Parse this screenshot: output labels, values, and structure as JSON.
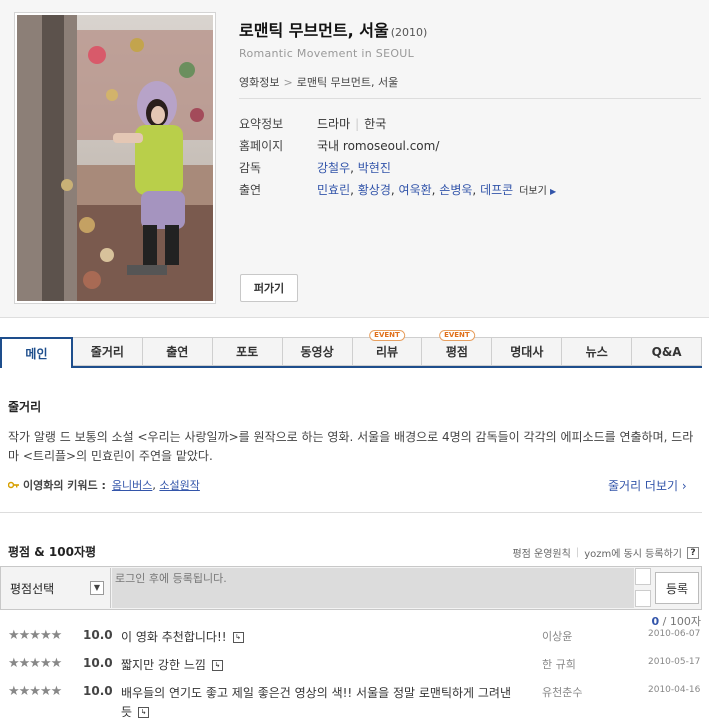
{
  "movie": {
    "title": "로맨틱 무브먼트, 서울",
    "year": "(2010)",
    "subtitle": "Romantic Movement in SEOUL"
  },
  "breadcrumb": [
    "영화정보",
    "로맨틱 무브먼트, 서울"
  ],
  "info": {
    "summary_label": "요약정보",
    "genre": "드라마",
    "country": "한국",
    "homepage_label": "홈페이지",
    "homepage_prefix": "국내",
    "homepage_url": "romoseoul.com/",
    "director_label": "감독",
    "directors": [
      "강철우",
      "박현진"
    ],
    "cast_label": "출연",
    "cast": [
      "민효린",
      "황상경",
      "여욱환",
      "손병욱",
      "데프콘"
    ],
    "cast_more": "더보기"
  },
  "scrap_button": "퍼가기",
  "tabs": [
    {
      "label": "메인",
      "badge": ""
    },
    {
      "label": "줄거리",
      "badge": ""
    },
    {
      "label": "출연",
      "badge": ""
    },
    {
      "label": "포토",
      "badge": ""
    },
    {
      "label": "동영상",
      "badge": ""
    },
    {
      "label": "리뷰",
      "badge": "EVENT"
    },
    {
      "label": "평점",
      "badge": "EVENT"
    },
    {
      "label": "명대사",
      "badge": ""
    },
    {
      "label": "뉴스",
      "badge": ""
    },
    {
      "label": "Q&A",
      "badge": ""
    }
  ],
  "synopsis": {
    "title": "줄거리",
    "text": "작가 알랭 드 보통의 소설 <우리는 사랑일까>를 원작으로 하는 영화. 서울을 배경으로 4명의 감독들이 각각의 에피소드를 연출하며, 드라마 <트리플>의 민효린이 주연을 맡았다.",
    "keyword_label": "이영화의 키워드 :",
    "keywords": [
      "옴니버스",
      "소설원작"
    ],
    "more": "줄거리 더보기"
  },
  "ratings": {
    "title": "평점 & 100자평",
    "policy_link": "평점 운영원칙",
    "yozm_link": "yozm에 동시 등록하기",
    "help": "?",
    "select_label": "평점선택",
    "placeholder": "로그인 후에 등록됩니다.",
    "submit": "등록",
    "count_current": "0",
    "count_max": "/ 100자",
    "reviews": [
      {
        "stars": "★★★★★",
        "score": "10.0",
        "text": "이 영화 추천합니다!!",
        "user": "이상윤",
        "date": "2010-06-07"
      },
      {
        "stars": "★★★★★",
        "score": "10.0",
        "text": "짧지만 강한 느낌",
        "user": "한 규희",
        "date": "2010-05-17"
      },
      {
        "stars": "★★★★★",
        "score": "10.0",
        "text": "배우들의 연기도 좋고 제일 좋은건 영상의 색!! 서울을 정말 로맨틱하게 그려낸듯",
        "user": "유천춘수",
        "date": "2010-04-16"
      }
    ]
  },
  "colors": {
    "accent": "#1e4e8c",
    "link": "#3355aa",
    "badge": "#e0701b"
  }
}
